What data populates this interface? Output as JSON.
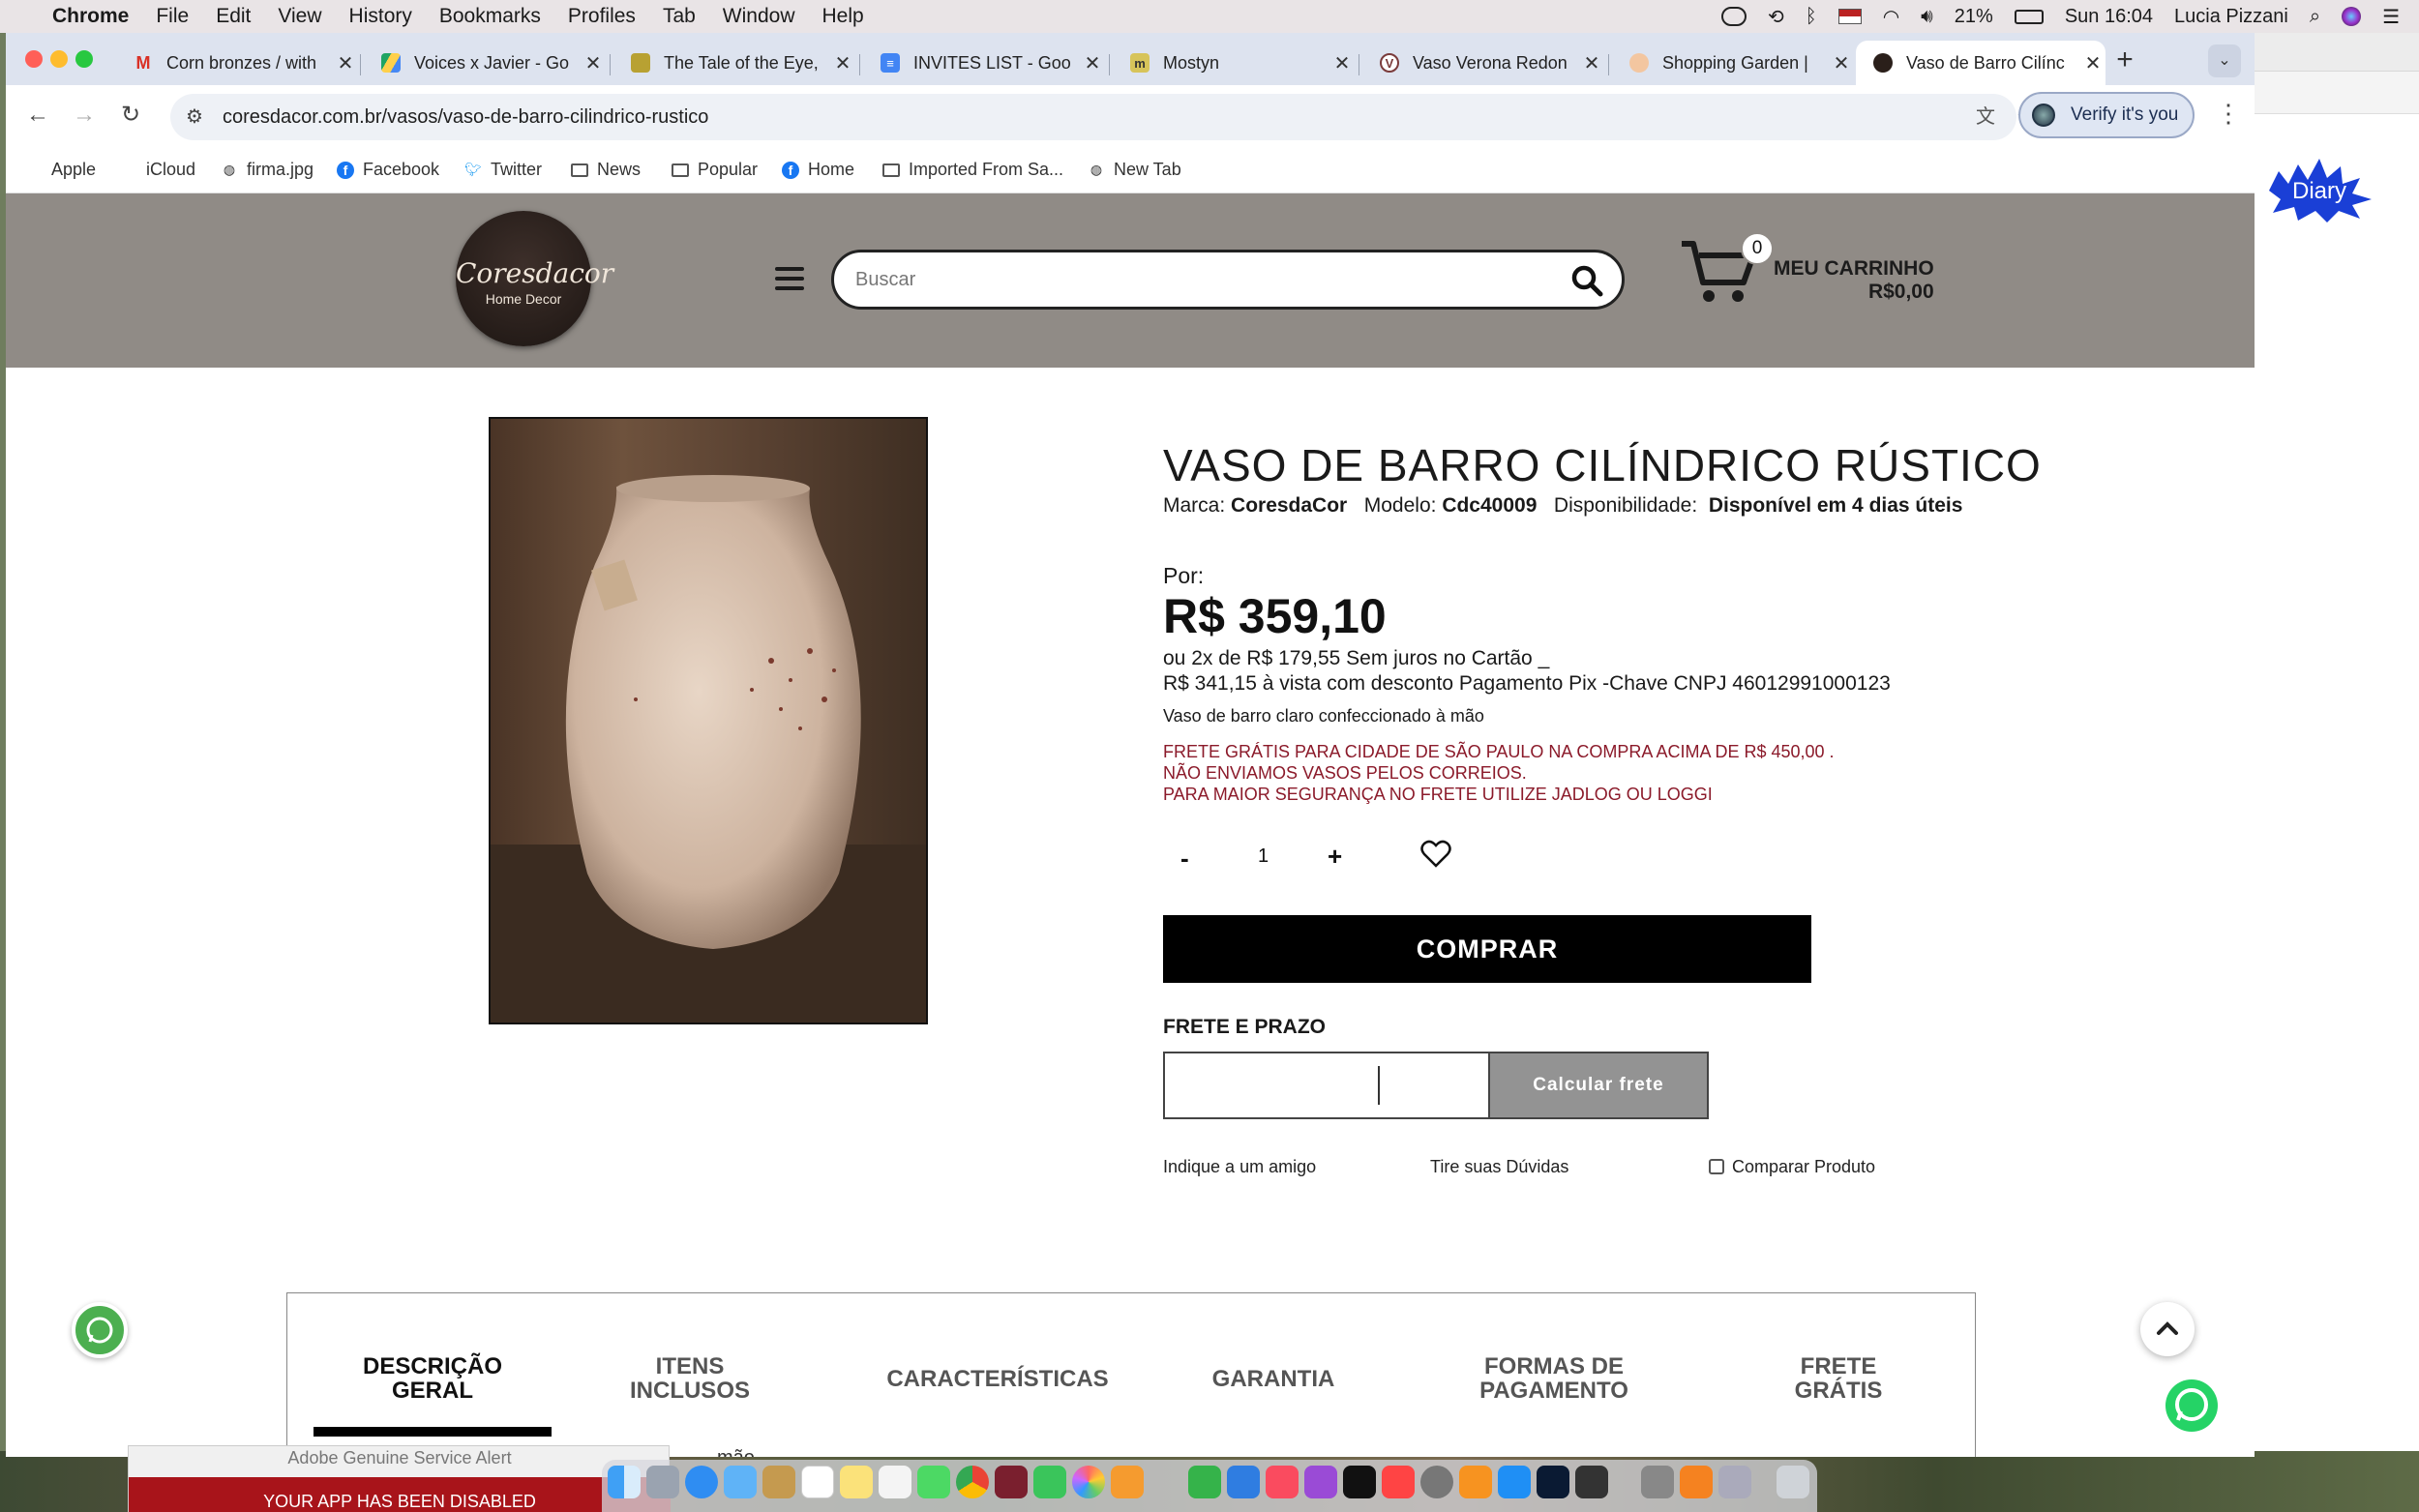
{
  "menubar": {
    "app": "Chrome",
    "items": [
      "File",
      "Edit",
      "View",
      "History",
      "Bookmarks",
      "Profiles",
      "Tab",
      "Window",
      "Help"
    ],
    "battery": "21%",
    "clock": "Sun 16:04",
    "user": "Lucia Pizzani"
  },
  "tabs": [
    {
      "title": "Corn bronzes / with",
      "icon": "gmail-icon"
    },
    {
      "title": "Voices x Javier - Go",
      "icon": "drive-icon"
    },
    {
      "title": "The Tale of the Eye,",
      "icon": "eye-icon"
    },
    {
      "title": "INVITES LIST - Goo",
      "icon": "docs-icon"
    },
    {
      "title": "Mostyn",
      "icon": "m-icon"
    },
    {
      "title": "Vaso Verona Redon",
      "icon": "v-icon"
    },
    {
      "title": "Shopping Garden |",
      "icon": "flower-icon"
    },
    {
      "title": "Vaso de Barro Cilínc",
      "icon": "site-icon"
    }
  ],
  "addressbar": {
    "url": "coresdacor.com.br/vasos/vaso-de-barro-cilindrico-rustico",
    "verify_label": "Verify it's you"
  },
  "bookmarks": [
    "Apple",
    "iCloud",
    "firma.jpg",
    "Facebook",
    "Twitter",
    "News",
    "Popular",
    "Home",
    "Imported From Sa...",
    "New Tab"
  ],
  "site": {
    "logo": {
      "name": "Coresdacor",
      "tagline": "Home Decor"
    },
    "search_placeholder": "Buscar",
    "cart": {
      "count": "0",
      "label": "MEU CARRINHO",
      "total": "R$0,00"
    }
  },
  "product": {
    "title": "VASO DE BARRO CILÍNDRICO RÚSTICO",
    "brand_label": "Marca:",
    "brand": "CoresdaCor",
    "model_label": "Modelo:",
    "model": "Cdc40009",
    "availability_label": "Disponibilidade:",
    "availability": "Disponível em 4 dias úteis",
    "por": "Por:",
    "price": "R$ 359,10",
    "installments": "ou 2x de R$ 179,55 Sem juros no Cartão _",
    "pix": "R$ 341,15 à vista com desconto Pagamento Pix -Chave CNPJ 46012991000123",
    "description": "Vaso de barro claro confeccionado à mão",
    "notices": [
      "FRETE GRÁTIS PARA CIDADE DE SÃO PAULO NA COMPRA ACIMA DE R$ 450,00 .",
      "NÃO ENVIAMOS VASOS PELOS CORREIOS.",
      "PARA MAIOR SEGURANÇA NO FRETE UTILIZE JADLOG OU LOGGI"
    ],
    "qty_minus": "-",
    "qty": "1",
    "qty_plus": "+",
    "buy_label": "COMPRAR",
    "shipping_label": "FRETE E PRAZO",
    "cep_value": "",
    "calc_label": "Calcular frete",
    "link_friend": "Indique a um amigo",
    "link_questions": "Tire suas Dúvidas",
    "compare_label": "Comparar Produto"
  },
  "product_tabs": [
    {
      "line1": "DESCRIÇÃO",
      "line2": "GERAL"
    },
    {
      "line1": "ITENS",
      "line2": "INCLUSOS"
    },
    {
      "line1": "CARACTERÍSTICAS",
      "line2": ""
    },
    {
      "line1": "GARANTIA",
      "line2": ""
    },
    {
      "line1": "FORMAS DE",
      "line2": "PAGAMENTO"
    },
    {
      "line1": "FRETE",
      "line2": "GRÁTIS"
    }
  ],
  "partial_text": "mão",
  "overlays": {
    "diary_label": "Diary",
    "alert_title": "Adobe Genuine Service Alert",
    "alert_text": "YOUR APP HAS BEEN DISABLED"
  },
  "colors": {
    "header_bg": "#908b86",
    "notice": "#8b1a2a",
    "buy_bg": "#000000",
    "whatsapp": "#25d366"
  }
}
